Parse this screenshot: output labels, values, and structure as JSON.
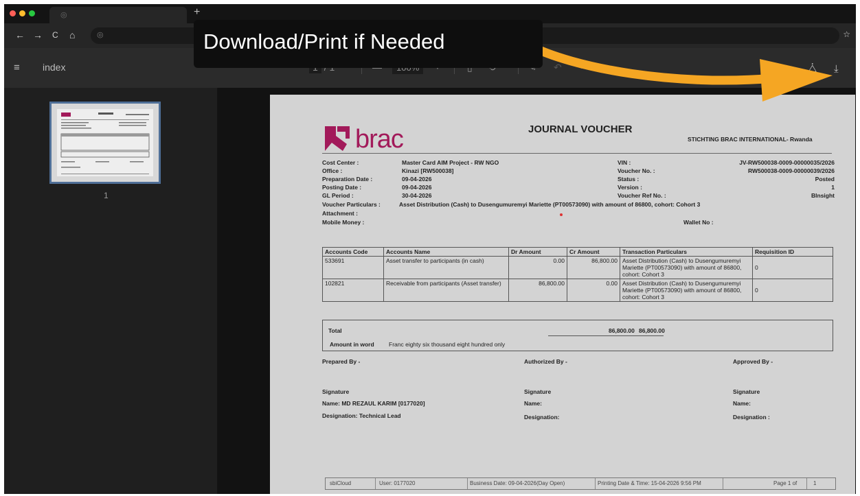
{
  "browser": {
    "nav": {
      "back": "←",
      "forward": "→",
      "reload": "C",
      "home": "⌂",
      "star": "☆"
    },
    "tab": {
      "icon": "globe-icon"
    },
    "new_tab": "+"
  },
  "pdf_toolbar": {
    "menu_icon": "≡",
    "title": "index",
    "page_current": "1",
    "page_total": "/ 1",
    "zoom_out": "—",
    "zoom": "100%",
    "zoom_in": "+",
    "download_icon": "⤓",
    "drive_icon": "⧊"
  },
  "sidebar": {
    "thumbnail_label": "1"
  },
  "overlay": {
    "text": "Download/Print if Needed",
    "arrow_color": "#f5a623"
  },
  "voucher": {
    "logo": "brac",
    "title": "JOURNAL VOUCHER",
    "org": "STICHTING BRAC INTERNATIONAL- Rwanda",
    "left_fields": [
      {
        "label": "Cost Center :",
        "value": "Master Card AIM Project - RW NGO"
      },
      {
        "label": "Office :",
        "value": "Kinazi [RW500038]"
      },
      {
        "label": "Preparation Date :",
        "value": "09-04-2026"
      },
      {
        "label": "Posting Date :",
        "value": "09-04-2026"
      },
      {
        "label": "GL Period :",
        "value": "30-04-2026"
      }
    ],
    "right_fields": [
      {
        "label": "VIN :",
        "value": "JV-RW500038-0009-00000035/2026"
      },
      {
        "label": "Voucher No. :",
        "value": "RW500038-0009-00000039/2026"
      },
      {
        "label": "Status :",
        "value": "Posted"
      },
      {
        "label": "Version :",
        "value": "1"
      },
      {
        "label": "Voucher Ref No. :",
        "value": "BInsight"
      }
    ],
    "particulars_label": "Voucher Particulars :",
    "particulars_value": "Asset Distribution (Cash) to Dusengumuremyi Mariette (PT00573090) with amount of 86800, cohort: Cohort 3",
    "attachment_label": "Attachment :",
    "mobile_money_label": "Mobile Money :",
    "wallet_label": "Wallet No :",
    "table_headers": [
      "Accounts Code",
      "Accounts Name",
      "Dr Amount",
      "Cr Amount",
      "Transaction Particulars",
      "Requisition ID"
    ],
    "rows": [
      {
        "code": "533691",
        "name": "Asset transfer to participants (in cash)",
        "dr": "0.00",
        "cr": "86,800.00",
        "particulars": "Asset Distribution (Cash) to Dusengumuremyi Mariette (PT00573090) with amount of 86800, cohort: Cohort 3",
        "req": "0"
      },
      {
        "code": "102821",
        "name": "Receivable from participants (Asset transfer)",
        "dr": "86,800.00",
        "cr": "0.00",
        "particulars": "Asset Distribution (Cash) to Dusengumuremyi Mariette (PT00573090) with amount of 86800, cohort: Cohort 3",
        "req": "0"
      }
    ],
    "total_label": "Total",
    "total_dr": "86,800.00",
    "total_cr": "86,800.00",
    "amount_word_label": "Amount in word",
    "amount_word": "Franc  eighty six thousand eight hundred only",
    "prepared_by": "Prepared By -",
    "authorized_by": "Authorized By -",
    "approved_by": "Approved By -",
    "signature": "Signature",
    "name_label": "Name:",
    "prepared_name": "Name: MD REZAUL KARIM [0177020]",
    "designation_label": "Designation:",
    "approved_designation_label": "Designation :",
    "prepared_designation": "Designation: Technical Lead",
    "footer": {
      "app": "sbiCloud",
      "user": "User: 0177020",
      "business_date": "Business Date: 09-04-2026(Day Open)",
      "printing": "Printing Date & Time: 15-04-2026 9:56 PM",
      "page": "Page 1 of",
      "page_total": "1"
    },
    "brand_color": "#a21a5a"
  }
}
